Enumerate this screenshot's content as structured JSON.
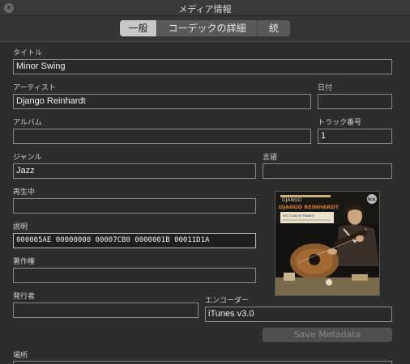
{
  "window": {
    "title": "メディア情報",
    "close_icon": "close-icon"
  },
  "tabs": [
    {
      "label": "一般",
      "active": true
    },
    {
      "label": "コーデックの詳細",
      "active": false
    },
    {
      "label": "統計",
      "active": false
    }
  ],
  "fields": {
    "title": {
      "label": "タイトル",
      "value": "Minor Swing"
    },
    "artist": {
      "label": "アーティスト",
      "value": "Django Reinhardt"
    },
    "date": {
      "label": "日付",
      "value": ""
    },
    "album": {
      "label": "アルバム",
      "value": ""
    },
    "track_number": {
      "label": "トラック番号",
      "value": "1"
    },
    "genre": {
      "label": "ジャンル",
      "value": "Jazz"
    },
    "language": {
      "label": "言語",
      "value": ""
    },
    "now_playing": {
      "label": "再生中",
      "value": ""
    },
    "description": {
      "label": "説明",
      "value": "000005AE 00000000 00007CB0 0000001B 00011D1A"
    },
    "copyright": {
      "label": "著作権",
      "value": ""
    },
    "publisher": {
      "label": "発行者",
      "value": ""
    },
    "encoder": {
      "label": "エンコーダー",
      "value": "iTunes v3.0"
    },
    "location": {
      "label": "場所",
      "value": ""
    }
  },
  "artwork": {
    "banner_top": "DJANGO",
    "banner_name": "DJANGO REINHARDT",
    "subtitle": "HOT CLUB OF FRANCE",
    "logo": "RCA"
  },
  "buttons": {
    "save_metadata": "Save Metadata"
  },
  "colors": {
    "background": "#2d2d2d",
    "field_border": "#8a8a8a",
    "active_tab": "#c8c8c8",
    "disabled_text": "#8a8a8a"
  }
}
